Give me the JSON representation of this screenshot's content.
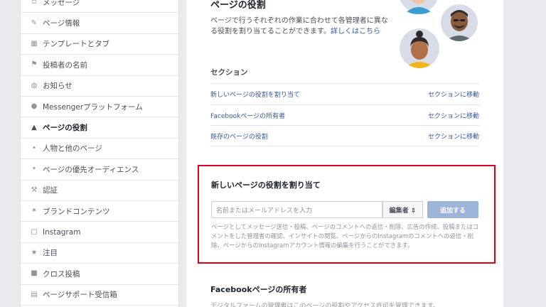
{
  "sidebar": {
    "items": [
      {
        "label": "メッセージ",
        "icon": "message-icon"
      },
      {
        "label": "ページ情報",
        "icon": "pencil-icon"
      },
      {
        "label": "テンプレートとタブ",
        "icon": "grid-icon"
      },
      {
        "label": "投稿者の名前",
        "icon": "flag-icon"
      },
      {
        "label": "お知らせ",
        "icon": "globe-icon"
      },
      {
        "label": "Messengerプラットフォーム",
        "icon": "messenger-icon"
      },
      {
        "label": "ページの役割",
        "icon": "person-icon",
        "active": true
      },
      {
        "label": "人物と他のページ",
        "icon": "people-icon"
      },
      {
        "label": "ページの優先オーディエンス",
        "icon": "people-icon"
      },
      {
        "label": "認証",
        "icon": "wrench-icon"
      },
      {
        "label": "ブランドコンテンツ",
        "icon": "handshake-icon"
      },
      {
        "label": "Instagram",
        "icon": "instagram-icon"
      },
      {
        "label": "注目",
        "icon": "star-icon"
      },
      {
        "label": "クロス投稿",
        "icon": "video-icon"
      },
      {
        "label": "ページサポート受信箱",
        "icon": "inbox-icon"
      }
    ]
  },
  "main": {
    "title": "ページの役割",
    "description": "ページで行うそれぞれの作業に合わせて各管理者に異なる役割を割り当てることができます。",
    "learn_more": "詳しくはこちら",
    "sections_heading": "セクション",
    "section_rows": [
      {
        "label": "新しいページの役割を割り当て",
        "link": "セクションに移動"
      },
      {
        "label": "Facebookページの所有者",
        "link": "セクションに移動"
      },
      {
        "label": "既存のページの役割",
        "link": "セクションに移動"
      }
    ],
    "assign": {
      "title": "新しいページの役割を割り当て",
      "placeholder": "名前またはメールアドレスを入力",
      "role": "編集者 ⇕",
      "button": "追加する",
      "help": "ページとしてメッセージ送信・投稿、ページのコメントへの返信・削除、広告の作成、投稿またはコメントをした管理者の確認、インサイトの閲覧、ページからのInstagramのコメントへの返信・削除、ページからのInstagramアカウント情報の編集を行うことができます。"
    },
    "owner": {
      "title": "Facebookページの所有者",
      "description": "デジタルファームの管理者はこのページの役割やアクセス許可を管理できます。"
    }
  },
  "colors": {
    "background": "#e9ebee",
    "link": "#365899",
    "highlight_border": "#e0001b",
    "button": "#9cb4d8"
  }
}
